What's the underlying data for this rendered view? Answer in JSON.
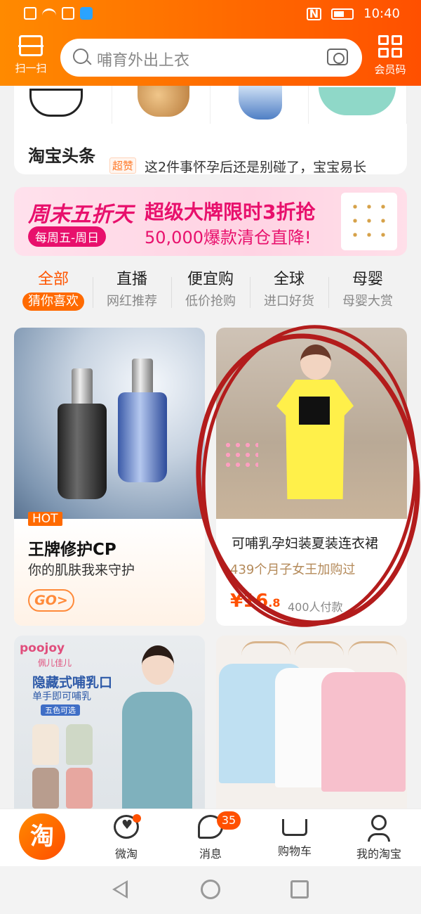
{
  "status_bar": {
    "time": "10:40"
  },
  "header": {
    "scan_label": "扫一扫",
    "member_label": "会员码",
    "search_placeholder": "哺育外出上衣"
  },
  "headline": {
    "title": "淘宝头条",
    "badge": "超赞",
    "text": "这2件事怀孕后还是别碰了，宝宝易长"
  },
  "banner": {
    "left_title": "周末五折天",
    "left_pill": "每周五-周日",
    "main_title": "超级大牌限时3折抢",
    "sub_title": "50,000爆款清仓直降!"
  },
  "category_tabs": [
    {
      "label": "全部",
      "sub": "猜你喜欢",
      "active": true
    },
    {
      "label": "直播",
      "sub": "网红推荐",
      "active": false
    },
    {
      "label": "便宜购",
      "sub": "低价抢购",
      "active": false
    },
    {
      "label": "全球",
      "sub": "进口好货",
      "active": false
    },
    {
      "label": "母婴",
      "sub": "母婴大赏",
      "active": false
    }
  ],
  "cards": {
    "promo": {
      "tag": "HOT",
      "title": "王牌修护CP",
      "subtitle": "你的肌肤我来守护",
      "go_label": "GO>"
    },
    "product": {
      "title": "可哺乳孕妇装夏装连衣裙",
      "subtitle": "439个月子女王加购过",
      "price_currency": "¥",
      "price_int": "16",
      "price_dec": ".8",
      "paid": "400人付款"
    },
    "tank": {
      "brand": "poojoy",
      "brand_cn": "佩儿佳儿",
      "headline": "隐藏式哺乳口",
      "subline": "单手即可哺乳",
      "colors": "五色可选"
    }
  },
  "tabbar": {
    "logo": "淘",
    "items": [
      {
        "label": "微淘"
      },
      {
        "label": "消息",
        "badge": "35"
      },
      {
        "label": "购物车"
      },
      {
        "label": "我的淘宝"
      }
    ]
  },
  "colors": {
    "brand": "#ff5000",
    "annotation": "#b31c1c"
  }
}
